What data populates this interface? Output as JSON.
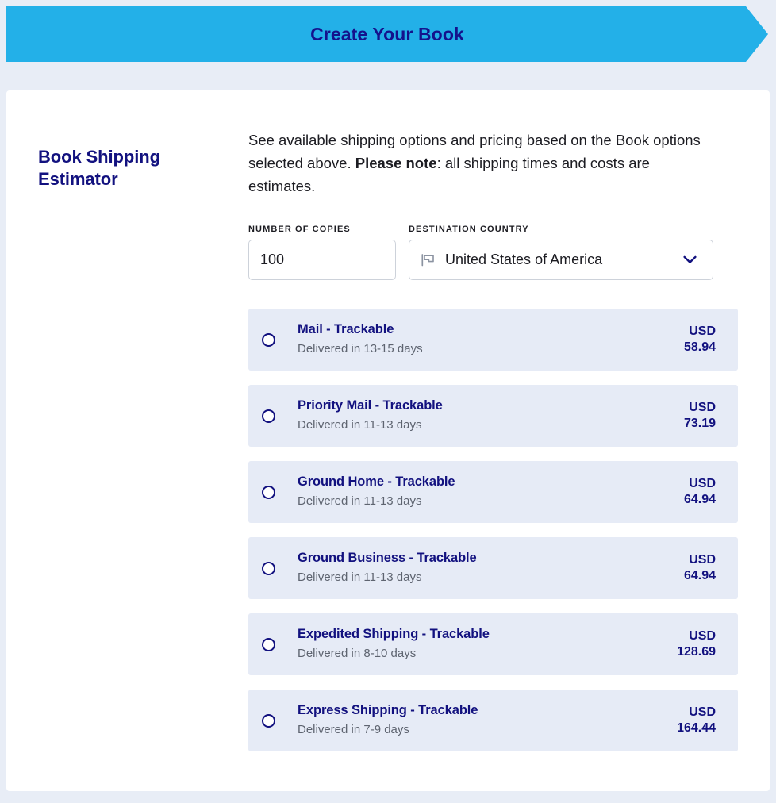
{
  "header": {
    "title": "Create Your Book",
    "background_color": "#23b0e8",
    "title_color": "#14128c"
  },
  "section": {
    "title": "Book Shipping Estimator",
    "description_part1": "See available shipping options and pricing based on the Book options selected above. ",
    "description_bold": "Please note",
    "description_part2": ": all shipping times and costs are estimates."
  },
  "form": {
    "copies": {
      "label": "NUMBER OF COPIES",
      "value": "100",
      "placeholder": ""
    },
    "country": {
      "label": "DESTINATION COUNTRY",
      "value": "United States of America",
      "flag_icon": "flag-icon",
      "chevron_icon": "chevron-down-icon"
    }
  },
  "shipping_options": [
    {
      "name": "Mail - Trackable",
      "delivery": "Delivered in 13-15 days",
      "currency": "USD",
      "price": "58.94",
      "selected": false
    },
    {
      "name": "Priority Mail - Trackable",
      "delivery": "Delivered in 11-13 days",
      "currency": "USD",
      "price": "73.19",
      "selected": false
    },
    {
      "name": "Ground Home - Trackable",
      "delivery": "Delivered in 11-13 days",
      "currency": "USD",
      "price": "64.94",
      "selected": false
    },
    {
      "name": "Ground Business - Trackable",
      "delivery": "Delivered in 11-13 days",
      "currency": "USD",
      "price": "64.94",
      "selected": false
    },
    {
      "name": "Expedited Shipping - Trackable",
      "delivery": "Delivered in 8-10 days",
      "currency": "USD",
      "price": "128.69",
      "selected": false
    },
    {
      "name": "Express Shipping - Trackable",
      "delivery": "Delivered in 7-9 days",
      "currency": "USD",
      "price": "164.44",
      "selected": false
    }
  ],
  "colors": {
    "page_background": "#e8edf6",
    "card_background": "#ffffff",
    "navy": "#12117f",
    "option_row_background": "#e6ebf6",
    "muted_text": "#5e6470"
  }
}
